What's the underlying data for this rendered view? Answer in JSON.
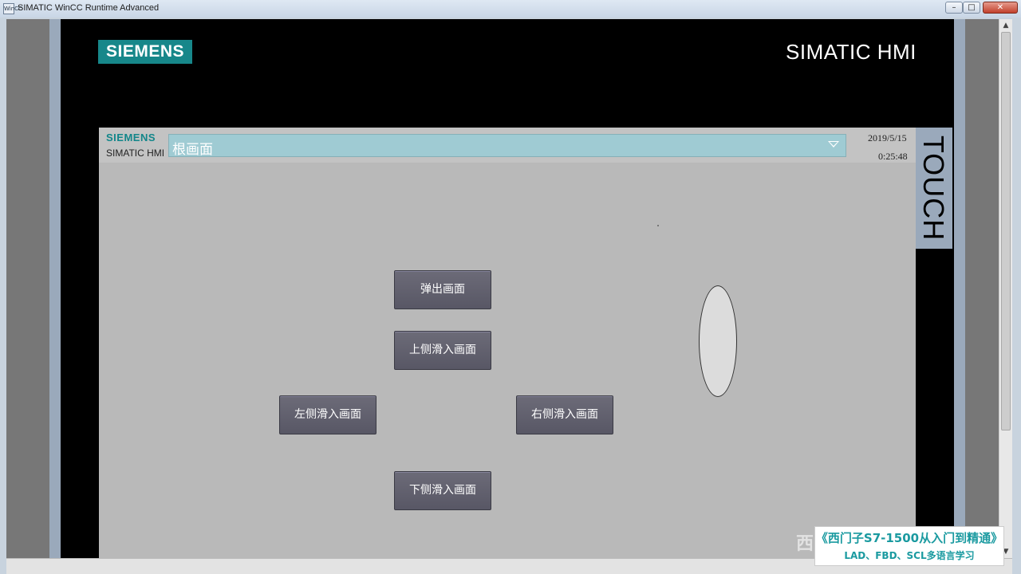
{
  "window": {
    "app_icon_text": "WinCC",
    "title": "SIMATIC WinCC Runtime Advanced",
    "controls": {
      "minimize": "–",
      "maximize": "□",
      "close": "✕"
    }
  },
  "panel_header": {
    "logo": "SIEMENS",
    "product": "SIMATIC HMI"
  },
  "screen_header": {
    "brand": "SIEMENS",
    "brand_sub": "SIMATIC HMI",
    "screen_select_value": "根画面",
    "date": "2019/5/15",
    "time": "0:25:48"
  },
  "touch_label": "TOUCH",
  "buttons": {
    "popup": "弹出画面",
    "slide_top": "上侧滑入画面",
    "slide_left": "左侧滑入画面",
    "slide_right": "右侧滑入画面",
    "slide_bottom": "下侧滑入画面"
  },
  "overlay": {
    "corner_char": "西",
    "promo_title": "《西门子S7-1500从入门到精通》",
    "promo_sub": "LAD、FBD、SCL多语言学习"
  },
  "colors": {
    "siemens_teal": "#17878a",
    "select_bg": "#9fcbd3",
    "button_bg": "#605f6d",
    "screen_bg": "#b9b9b9"
  },
  "icons": [
    "chevron-down-icon",
    "scroll-up-icon",
    "scroll-down-icon"
  ]
}
